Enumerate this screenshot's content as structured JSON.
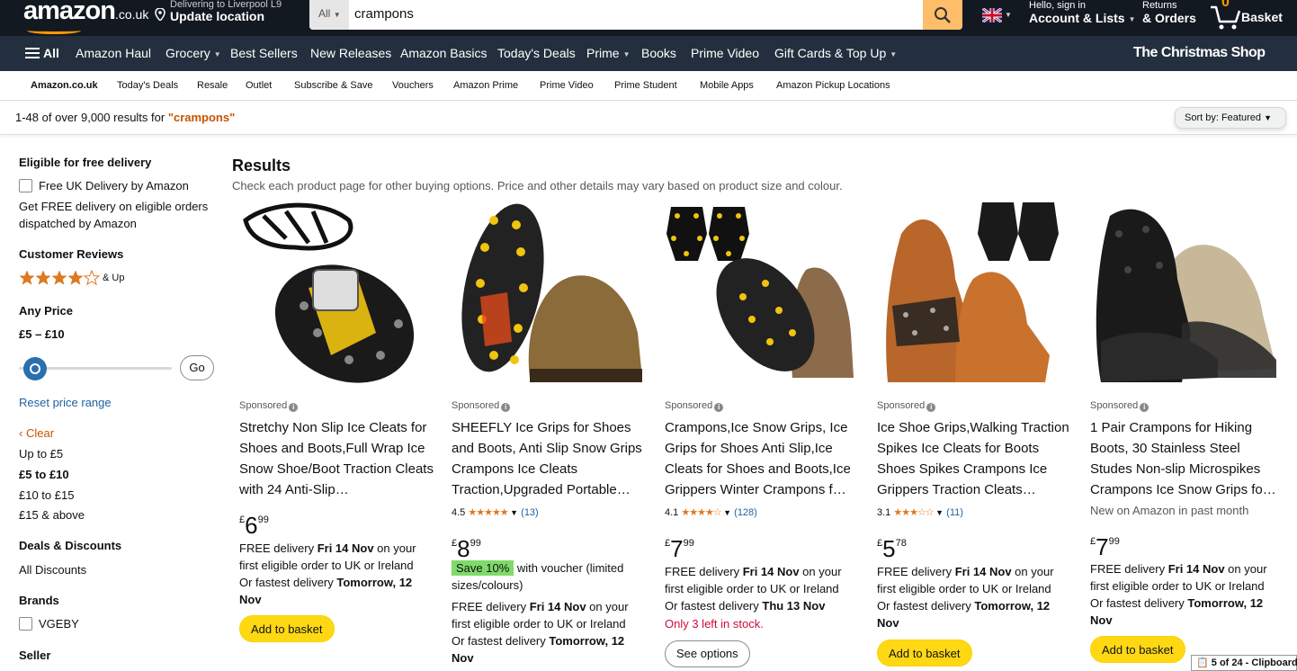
{
  "header": {
    "logo_text": "amazon",
    "logo_tld": ".co.uk",
    "location_line1": "Delivering to Liverpool L9",
    "location_line2": "Update location",
    "search_category": "All",
    "search_value": "crampons",
    "account_line1": "Hello, sign in",
    "account_line2": "Account & Lists",
    "returns_line1": "Returns",
    "returns_line2": "& Orders",
    "cart_count": "0",
    "cart_label": "Basket"
  },
  "nav": {
    "all": "All",
    "items": [
      "Amazon Haul",
      "Grocery",
      "Best Sellers",
      "New Releases",
      "Amazon Basics",
      "Today's Deals",
      "Prime",
      "Books",
      "Prime Video",
      "Gift Cards & Top Up"
    ],
    "promo": "The Christmas Shop"
  },
  "subnav": [
    "Amazon.co.uk",
    "Today's Deals",
    "Resale",
    "Outlet",
    "Subscribe & Save",
    "Vouchers",
    "Amazon Prime",
    "Prime Video",
    "Prime Student",
    "Mobile Apps",
    "Amazon Pickup Locations"
  ],
  "results_bar": {
    "count_text": "1-48 of over 9,000 results for ",
    "query": "\"crampons\"",
    "sort_label": "Sort by: Featured"
  },
  "sidebar": {
    "free_delivery_heading": "Eligible for free delivery",
    "free_delivery_option": "Free UK Delivery by Amazon",
    "free_delivery_note_1": "Get FREE delivery on eligible orders",
    "free_delivery_note_2": "dispatched by Amazon",
    "reviews_heading": "Customer Reviews",
    "reviews_up": "& Up",
    "reviews_min_stars": 4,
    "price_heading": "Any Price",
    "price_range": "£5 – £10",
    "go_label": "Go",
    "reset_label": "Reset price range",
    "clear_label": "Clear",
    "price_options": [
      "Up to £5",
      "£5 to £10",
      "£10 to £15",
      "£15 & above"
    ],
    "deals_heading": "Deals & Discounts",
    "deals_option": "All Discounts",
    "brands_heading": "Brands",
    "brand_option": "VGEBY",
    "seller_heading": "Seller"
  },
  "results": {
    "heading": "Results",
    "subtext": "Check each product page for other buying options. Price and other details may vary based on product size and colour."
  },
  "products": [
    {
      "sponsored": "Sponsored",
      "title": "Stretchy Non Slip Ice Cleats for Shoes and Boots,Full Wrap Ice Snow Shoe/Boot Traction Cleats with 24 Anti-Slip…",
      "price_currency": "£",
      "price_whole": "6",
      "price_fraction": "99",
      "delivery_1": "FREE delivery ",
      "delivery_date": "Fri 14 Nov",
      "delivery_2": " on your first eligible order to UK or Ireland",
      "fast_1": "Or fastest delivery ",
      "fast_date": "Tomorrow, 12 Nov",
      "button": "Add to basket"
    },
    {
      "sponsored": "Sponsored",
      "title": "SHEEFLY Ice Grips for Shoes and Boots, Anti Slip Snow Grips Crampons Ice Cleats Traction,Upgraded Portable…",
      "rating": "4.5",
      "stars": 4.5,
      "rating_count": "(13)",
      "price_currency": "£",
      "price_whole": "8",
      "price_fraction": "99",
      "save_badge": "Save 10%",
      "save_text": " with voucher (limited sizes/colours)",
      "delivery_1": "FREE delivery ",
      "delivery_date": "Fri 14 Nov",
      "delivery_2": " on your first eligible order to UK or Ireland",
      "fast_1": "Or fastest delivery ",
      "fast_date": "Tomorrow, 12 Nov"
    },
    {
      "sponsored": "Sponsored",
      "title": "Crampons,Ice Snow Grips, Ice Grips for Shoes Anti Slip,Ice Cleats for Shoes and Boots,Ice Grippers Winter Crampons f…",
      "rating": "4.1",
      "stars": 4.1,
      "rating_count": "(128)",
      "price_currency": "£",
      "price_whole": "7",
      "price_fraction": "99",
      "delivery_1": "FREE delivery ",
      "delivery_date": "Fri 14 Nov",
      "delivery_2": " on your first eligible order to UK or Ireland",
      "fast_1": "Or fastest delivery ",
      "fast_date": "Thu 13 Nov",
      "stock": "Only 3 left in stock.",
      "button": "See options"
    },
    {
      "sponsored": "Sponsored",
      "title": "Ice Shoe Grips,Walking Traction Spikes Ice Cleats for Boots Shoes Spikes Crampons Ice Grippers Traction Cleats…",
      "rating": "3.1",
      "stars": 3.1,
      "rating_count": "(11)",
      "price_currency": "£",
      "price_whole": "5",
      "price_fraction": "78",
      "delivery_1": "FREE delivery ",
      "delivery_date": "Fri 14 Nov",
      "delivery_2": " on your first eligible order to UK or Ireland",
      "fast_1": "Or fastest delivery ",
      "fast_date": "Tomorrow, 12 Nov",
      "button": "Add to basket"
    },
    {
      "sponsored": "Sponsored",
      "title": "1 Pair Crampons for Hiking Boots, 30 Stainless Steel Studes Non-slip Microspikes Crampons Ice Snow Grips fo…",
      "new_tag": "New on Amazon in past month",
      "price_currency": "£",
      "price_whole": "7",
      "price_fraction": "99",
      "delivery_1": "FREE delivery ",
      "delivery_date": "Fri 14 Nov",
      "delivery_2": " on your first eligible order to UK or Ireland",
      "fast_1": "Or fastest delivery ",
      "fast_date": "Tomorrow, 12 Nov",
      "button": "Add to basket"
    }
  ],
  "clipboard_badge": "5 of 24 - Clipboard",
  "colors": {
    "nav_dark": "#131921",
    "nav_mid": "#232f3e",
    "accent": "#febd69",
    "button_yellow": "#ffd814",
    "star": "#de7921",
    "link": "#2162a1"
  }
}
